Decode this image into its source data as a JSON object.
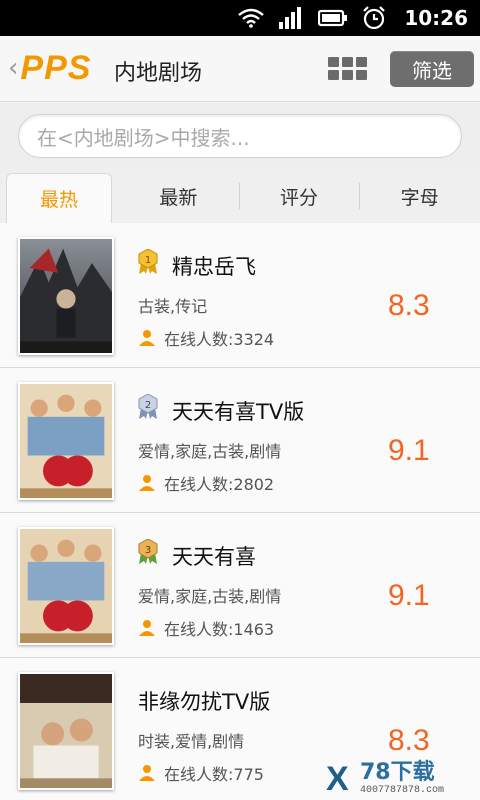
{
  "status_bar": {
    "time": "10:26",
    "icons": [
      "wifi-icon",
      "signal-icon",
      "battery-icon",
      "alarm-icon"
    ]
  },
  "header": {
    "logo_text": "PPS",
    "title": "内地剧场",
    "filter_label": "筛选",
    "icons": [
      "back-icon",
      "grid-view-icon"
    ]
  },
  "search": {
    "placeholder": "在<内地剧场>中搜索..."
  },
  "tabs": [
    {
      "label": "最热",
      "active": true
    },
    {
      "label": "最新",
      "active": false
    },
    {
      "label": "评分",
      "active": false
    },
    {
      "label": "字母",
      "active": false
    }
  ],
  "items": [
    {
      "rank": "1",
      "title": "精忠岳飞",
      "genre": "古装,传记",
      "online": "在线人数:3324",
      "score": "8.3"
    },
    {
      "rank": "2",
      "title": "天天有喜TV版",
      "genre": "爱情,家庭,古装,剧情",
      "online": "在线人数:2802",
      "score": "9.1"
    },
    {
      "rank": "3",
      "title": "天天有喜",
      "genre": "爱情,家庭,古装,剧情",
      "online": "在线人数:1463",
      "score": "9.1"
    },
    {
      "rank": "",
      "title": "非缘勿扰TV版",
      "genre": "时装,爱情,剧情",
      "online": "在线人数:775",
      "score": "8.3"
    }
  ],
  "watermark": {
    "text": "78下载",
    "phone": "4007787878.com"
  },
  "colors": {
    "accent": "#f39800",
    "score": "#f26522",
    "header_bg": "#f7f7f7"
  }
}
